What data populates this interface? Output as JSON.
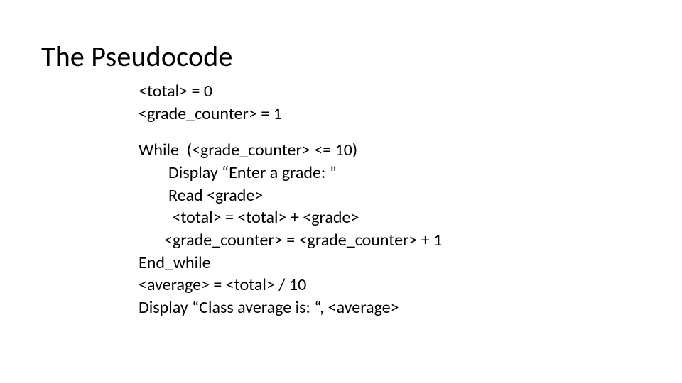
{
  "title": "The Pseudocode",
  "lines": {
    "l1": "<total> = 0",
    "l2": "<grade_counter> = 1",
    "l3": "While  (<grade_counter> <= 10)",
    "l4": "Display “Enter a grade: ”",
    "l5": "Read <grade>",
    "l6": " <total> = <total> + <grade>",
    "l7": "<grade_counter> = <grade_counter> + 1",
    "l8": "End_while",
    "l9": "<average> = <total> / 10",
    "l10": "Display “Class average is: “, <average>"
  }
}
